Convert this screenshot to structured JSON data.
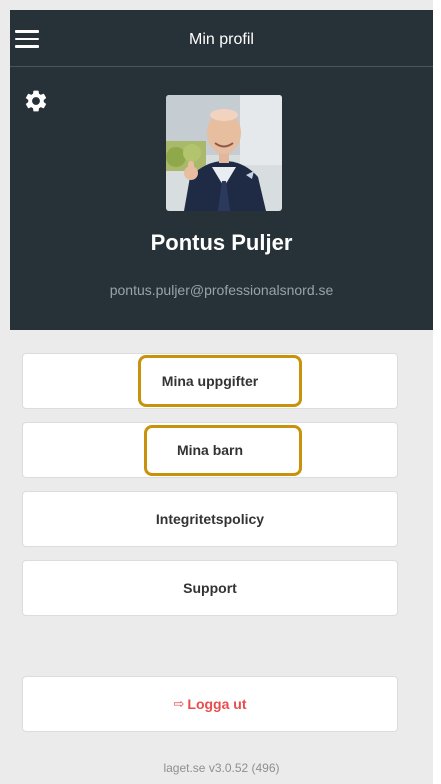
{
  "header": {
    "title": "Min profil"
  },
  "profile": {
    "name": "Pontus Puljer",
    "email": "pontus.puljer@professionalsnord.se"
  },
  "menu": {
    "items": [
      {
        "label": "Mina uppgifter"
      },
      {
        "label": "Mina barn"
      },
      {
        "label": "Integritetspolicy"
      },
      {
        "label": "Support"
      }
    ],
    "logout_label": "Logga ut"
  },
  "footer": {
    "version": "laget.se v3.0.52 (496)"
  },
  "colors": {
    "header_bg": "#263138",
    "page_bg": "#ebebeb",
    "logout_red": "#e84c4c",
    "highlight": "#c8930a"
  },
  "icons": {
    "menu": "hamburger-menu-icon",
    "settings": "gear-icon",
    "logout": "logout-icon"
  }
}
